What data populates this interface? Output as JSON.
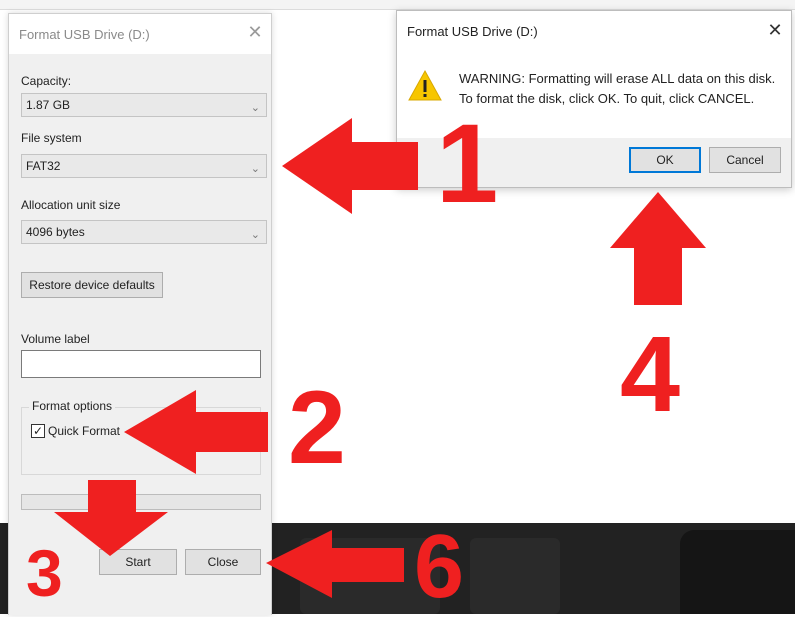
{
  "format_dialog": {
    "title": "Format USB Drive (D:)",
    "close_glyph": "✕",
    "capacity_label": "Capacity:",
    "capacity_value": "1.87 GB",
    "filesystem_label": "File system",
    "filesystem_value": "FAT32",
    "allocation_label": "Allocation unit size",
    "allocation_value": "4096 bytes",
    "restore_button": "Restore device defaults",
    "volume_label": "Volume label",
    "volume_value": "",
    "format_options_label": "Format options",
    "quick_format_label": "Quick Format",
    "quick_format_checked": true,
    "start_button": "Start",
    "close_button": "Close"
  },
  "warning_dialog": {
    "title": "Format USB Drive (D:)",
    "close_glyph": "✕",
    "message_line1": "WARNING: Formatting will erase ALL data on this disk.",
    "message_line2": "To format the disk, click OK. To quit, click CANCEL.",
    "ok_button": "OK",
    "cancel_button": "Cancel",
    "icon": "warning-triangle-icon"
  },
  "annotations": {
    "step_1": "1",
    "step_2": "2",
    "step_3": "3",
    "step_4": "4",
    "step_6": "6",
    "arrow_color": "#ef2020"
  }
}
